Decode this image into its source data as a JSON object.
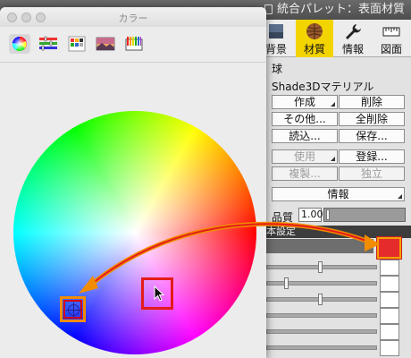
{
  "palette": {
    "title": "統合パレット：表面材質",
    "tabs": [
      {
        "label": "背景",
        "icon": "background-icon",
        "active": false
      },
      {
        "label": "材質",
        "icon": "material-sphere-icon",
        "active": true
      },
      {
        "label": "情報",
        "icon": "wrench-icon",
        "active": false
      },
      {
        "label": "図面",
        "icon": "ruler-icon",
        "active": false
      }
    ],
    "object_name": "球",
    "material_name": "Shade3Dマテリアル",
    "buttons": {
      "create": "作成",
      "delete": "削除",
      "other": "その他...",
      "delete_all": "全削除",
      "load": "読込...",
      "save": "保存...",
      "use": "使用",
      "register": "登録...",
      "duplicate": "複製...",
      "independent": "独立",
      "info": "情報"
    },
    "quality_label": "品質",
    "quality_value": "1.00",
    "section_label": "本設定",
    "base_color": "#e52b2b"
  },
  "color_window": {
    "title": "カラー",
    "tools": [
      "color-wheel-icon",
      "color-sliders-icon",
      "color-palettes-icon",
      "image-palettes-icon",
      "pencils-icon"
    ],
    "selected_color": "#1a10c8"
  },
  "annotation": {
    "arrow_color": "#f28c00"
  }
}
